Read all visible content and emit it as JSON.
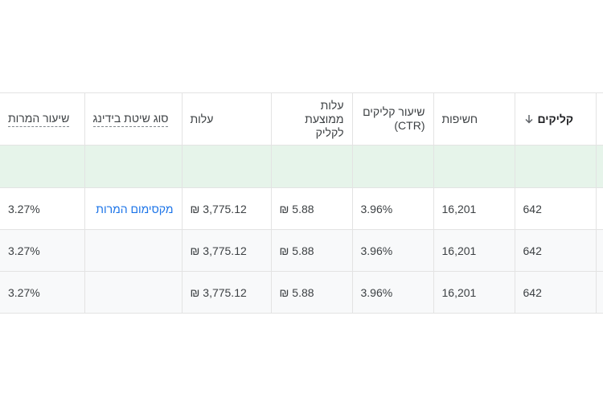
{
  "headers": {
    "conversion_rate": "שיעור המרות",
    "bid_strategy_type": "סוג שיטת בידינג",
    "cost": "עלות",
    "avg_cpc": "עלות ממוצעת לקליק",
    "ctr": "שיעור קליקים (CTR)",
    "impressions": "חשיפות",
    "clicks": "קליקים",
    "sort_icon": "arrow-down-icon"
  },
  "rows": [
    {
      "conversion_rate": "3.27%",
      "bid_strategy_type": "מקסימום המרות",
      "cost": "₪ 3,775.12",
      "avg_cpc": "₪ 5.88",
      "ctr": "3.96%",
      "impressions": "16,201",
      "clicks": "642"
    },
    {
      "conversion_rate": "3.27%",
      "bid_strategy_type": "",
      "cost": "₪ 3,775.12",
      "avg_cpc": "₪ 5.88",
      "ctr": "3.96%",
      "impressions": "16,201",
      "clicks": "642"
    },
    {
      "conversion_rate": "3.27%",
      "bid_strategy_type": "",
      "cost": "₪ 3,775.12",
      "avg_cpc": "₪ 5.88",
      "ctr": "3.96%",
      "impressions": "16,201",
      "clicks": "642"
    }
  ],
  "colors": {
    "total_row_bg": "#e6f4ea",
    "link": "#1a73e8",
    "border": "#e3e3e3"
  }
}
